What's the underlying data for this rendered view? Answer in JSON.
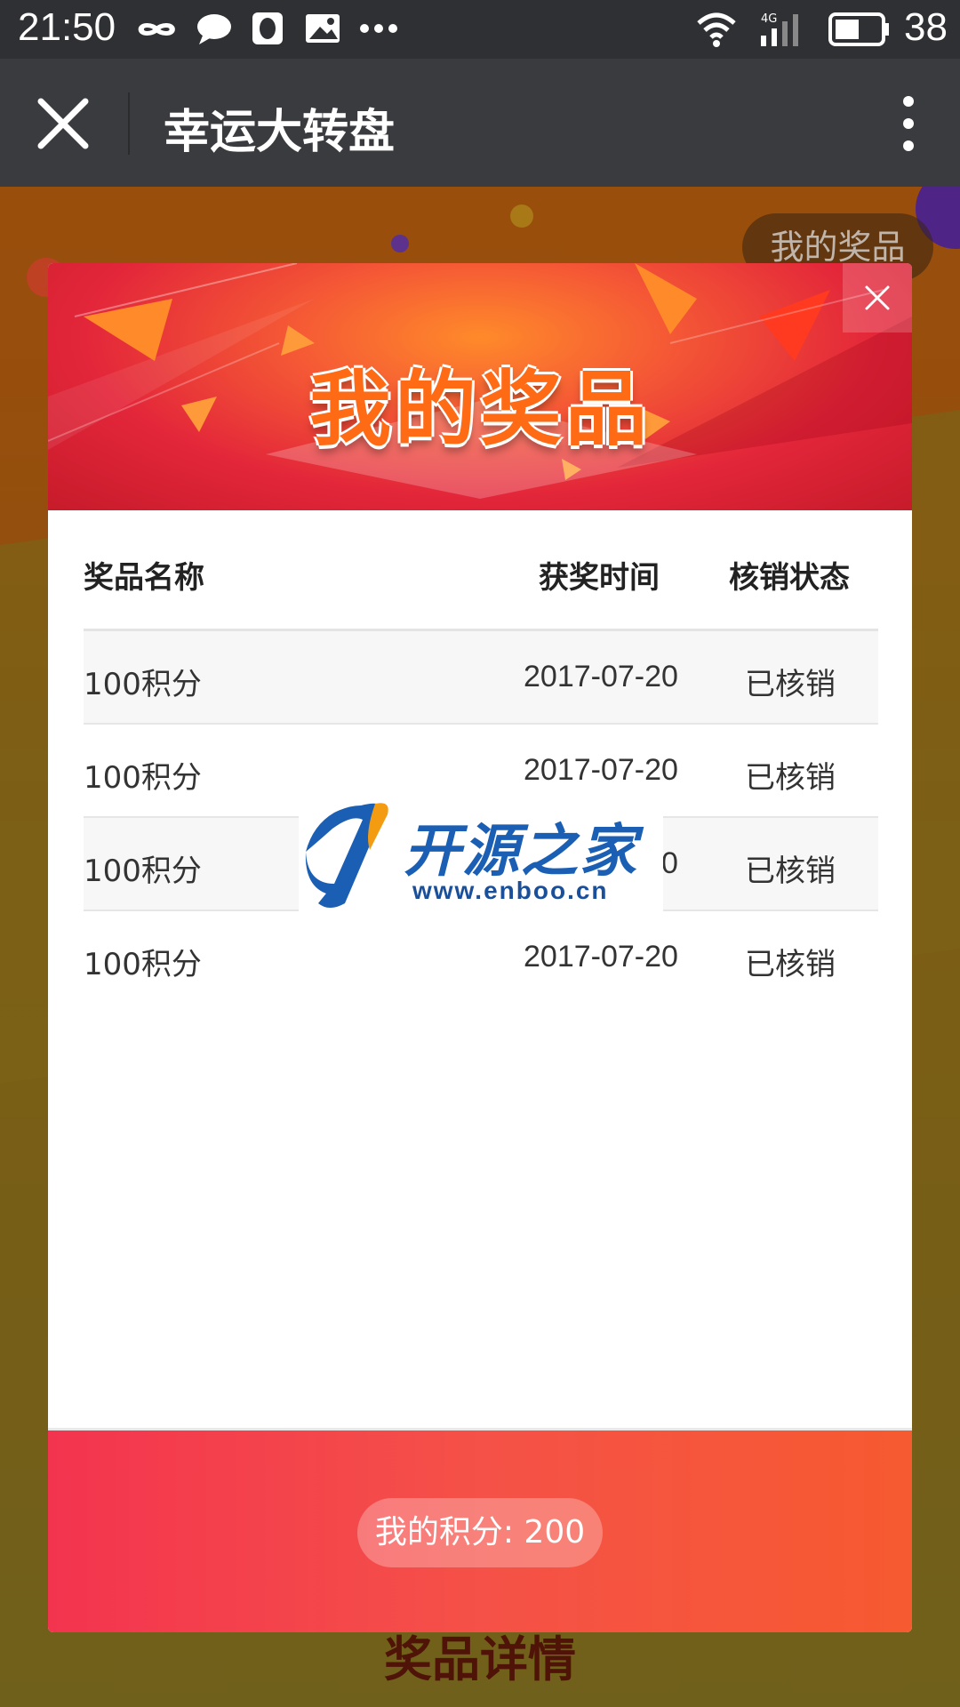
{
  "status_bar": {
    "time": "21:50",
    "network": "4G",
    "battery": "38"
  },
  "nav": {
    "title": "幸运大转盘"
  },
  "background": {
    "my_prizes_button": "我的奖品",
    "prize_details_heading": "奖品详情"
  },
  "modal": {
    "banner_title": "我的奖品",
    "columns": [
      "奖品名称",
      "获奖时间",
      "核销状态"
    ],
    "rows": [
      {
        "name": "100积分",
        "time": "2017-07-20",
        "status": "已核销"
      },
      {
        "name": "100积分",
        "time": "2017-07-20",
        "status": "已核销"
      },
      {
        "name": "100积分",
        "time": "2017-07-20",
        "status": "已核销"
      },
      {
        "name": "100积分",
        "time": "2017-07-20",
        "status": "已核销"
      }
    ],
    "points_label": "我的积分: 200"
  },
  "watermark": {
    "name": "开源之家",
    "url": "www.enboo.cn"
  },
  "colors": {
    "status_bar": "#2f3033",
    "nav_bar": "#3a3b3e",
    "banner_red": "#e3263a",
    "footer_start": "#f3344f",
    "footer_end": "#f65a30"
  }
}
